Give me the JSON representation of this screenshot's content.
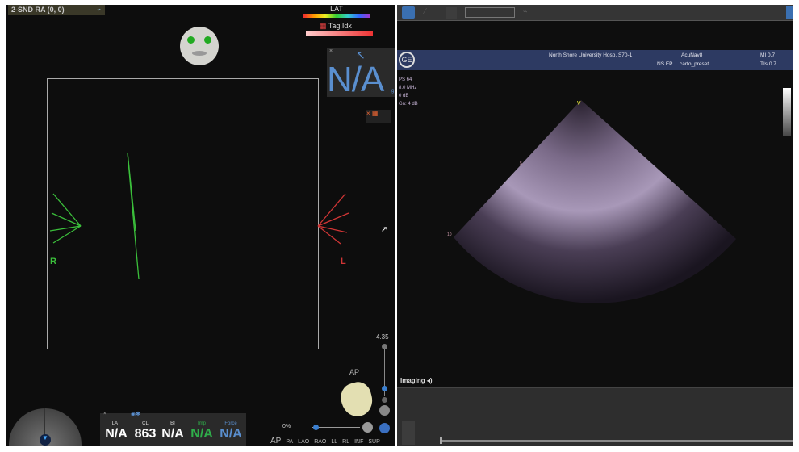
{
  "left": {
    "map_selector": "2-SND RA (0, 0)",
    "lat_legend": "LAT",
    "tag_legend": "Tag.Idx",
    "label_r": "R",
    "label_l": "L",
    "direction_box": {
      "close": "×",
      "value": "N/A",
      "unit": "g"
    },
    "zoom_value": "4.35",
    "orientation_label": "AP",
    "rotation_percent": "0%",
    "views": [
      "AP",
      "PA",
      "LAO",
      "RAO",
      "LL",
      "RL",
      "INF",
      "SUP"
    ],
    "stats": {
      "close": "×",
      "columns": [
        {
          "header": "LAT",
          "value": "N/A",
          "color": "#ffffff"
        },
        {
          "header": "CL",
          "value": "863",
          "color": "#ffffff"
        },
        {
          "header": "BI",
          "value": "N/A",
          "color": "#ffffff"
        },
        {
          "header": "Imp",
          "value": "N/A",
          "color": "#2fae4a"
        },
        {
          "header": "Force",
          "value": "N/A",
          "color": "#5a8fcf"
        }
      ]
    }
  },
  "right": {
    "header": {
      "hospital": "North Shore University Hosp. S70-1",
      "probe": "AcuNav8",
      "mi": "MI 0.7",
      "dept": "NS EP",
      "preset": "carto_preset",
      "tis": "TIs 0.7"
    },
    "params": [
      "PS 64",
      "8.0 MHz",
      "0 dB",
      "Gn: 4 dB"
    ],
    "depth_marks": [
      "5",
      "10"
    ],
    "imaging_label": "Imaging"
  }
}
